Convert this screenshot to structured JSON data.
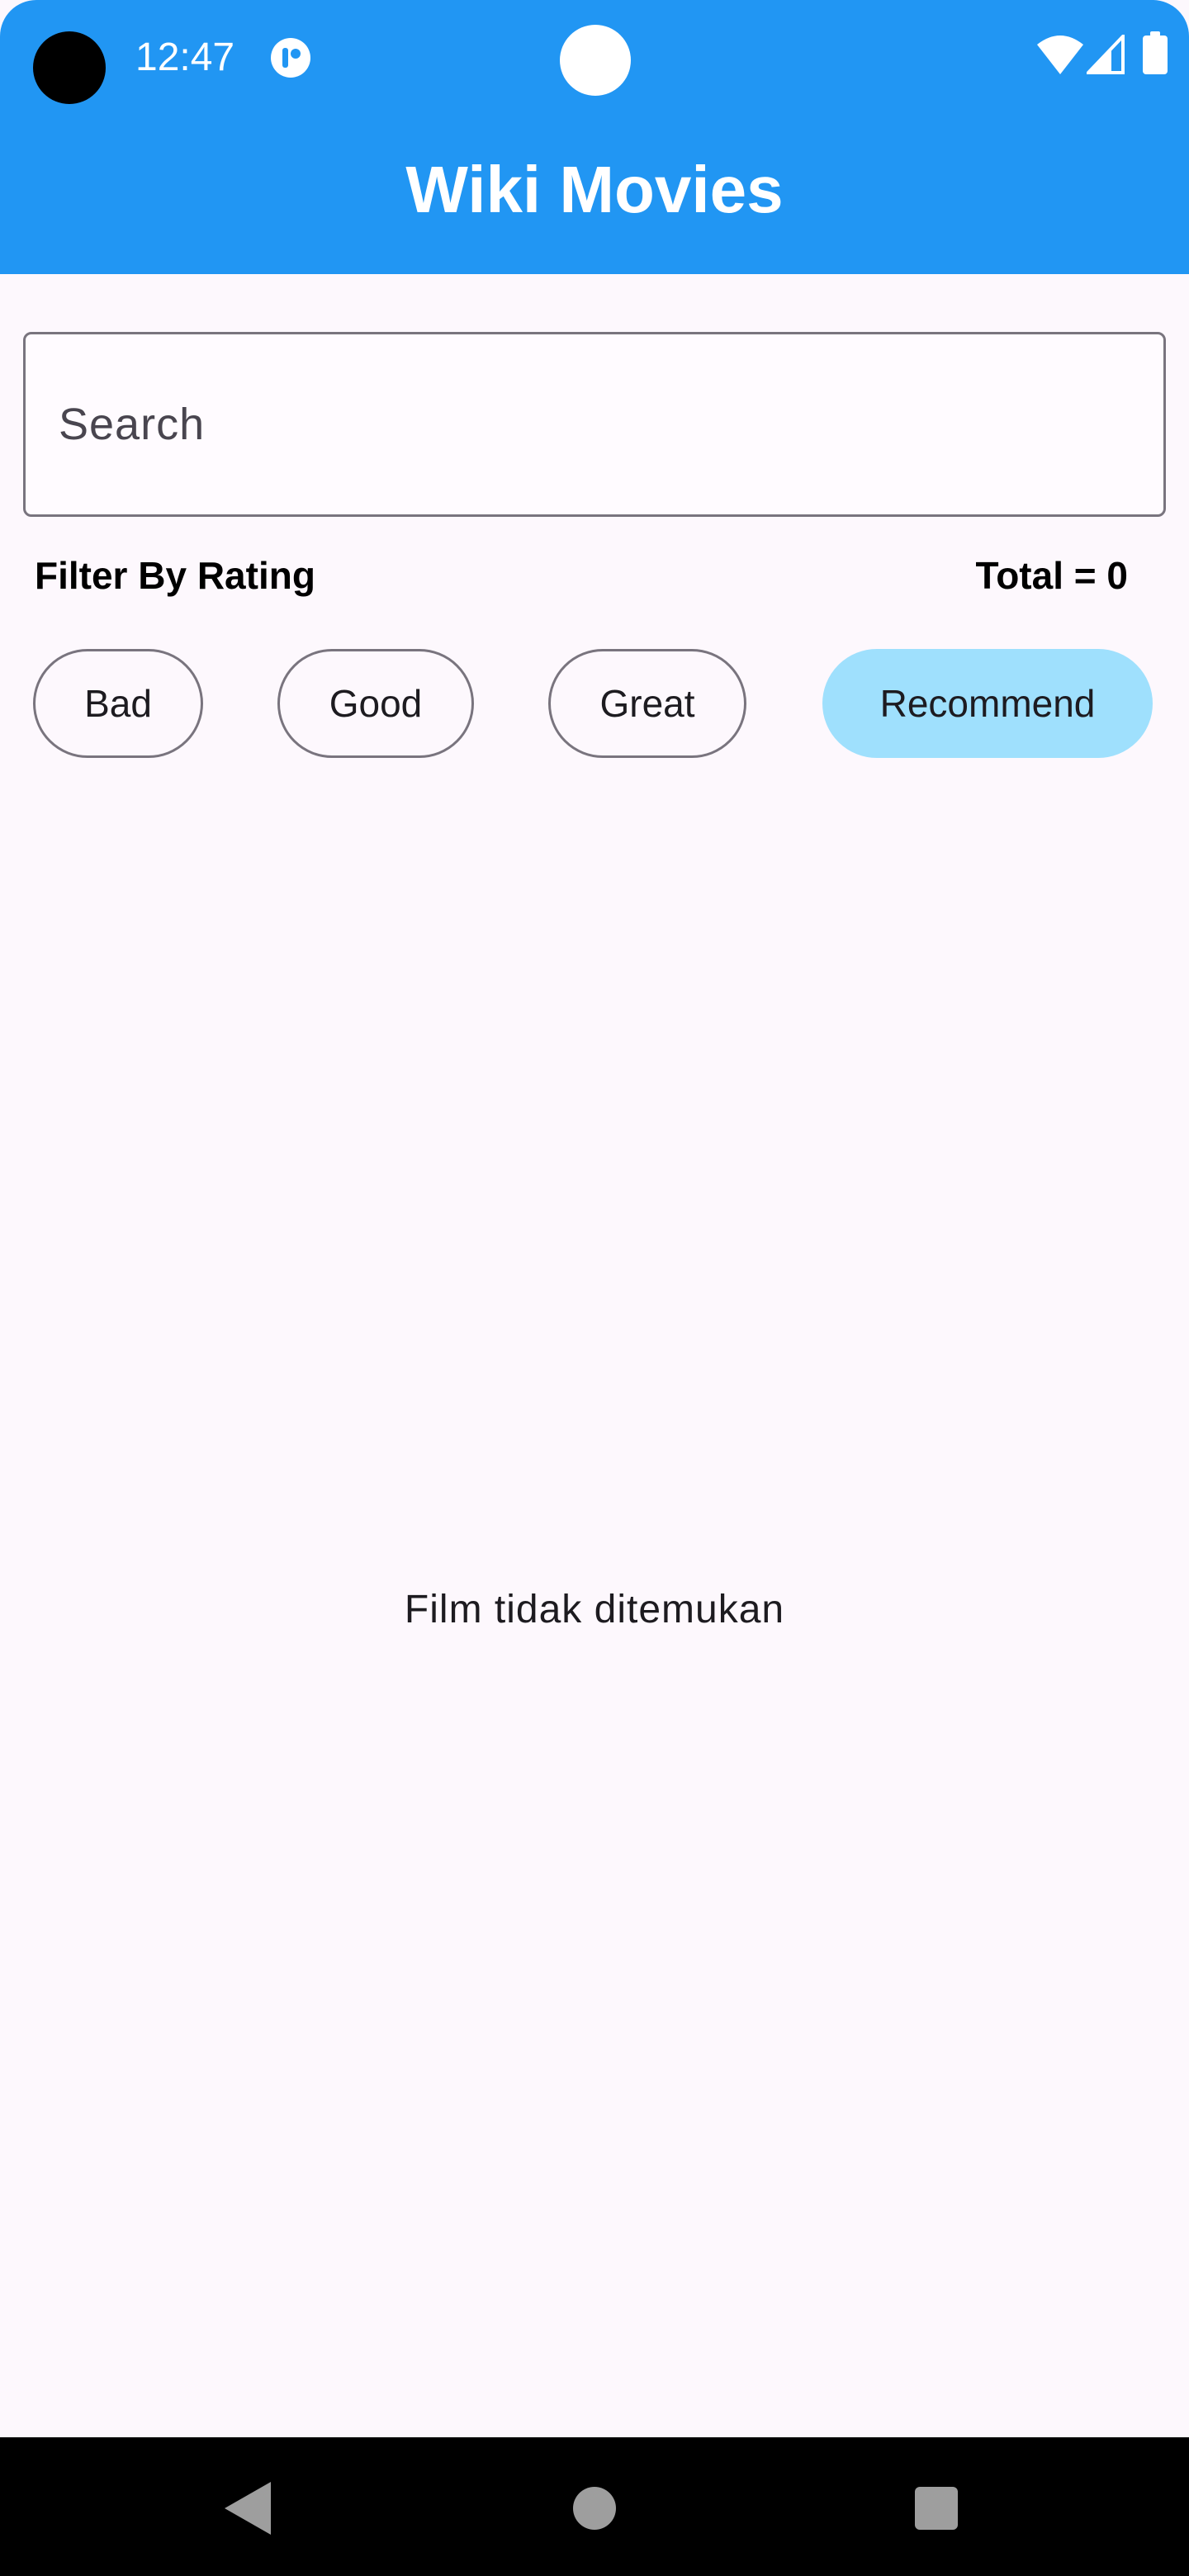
{
  "status_bar": {
    "time": "12:47",
    "icons": [
      "camera-dot",
      "app-notification-icon",
      "center-dot",
      "wifi-icon",
      "cell-signal-icon",
      "battery-icon"
    ]
  },
  "app_bar": {
    "title": "Wiki Movies",
    "color": "#2196f3"
  },
  "search": {
    "placeholder": "Search",
    "value": ""
  },
  "filter": {
    "label": "Filter By Rating",
    "total": "Total = 0",
    "chips": [
      {
        "label": "Bad",
        "selected": false
      },
      {
        "label": "Good",
        "selected": false
      },
      {
        "label": "Great",
        "selected": false
      },
      {
        "label": "Recommend",
        "selected": true
      }
    ],
    "selected_color": "#9fe0fd"
  },
  "content": {
    "empty_message": "Film tidak ditemukan"
  },
  "nav_bar": {
    "buttons": [
      "back-icon",
      "home-icon",
      "recents-icon"
    ]
  }
}
